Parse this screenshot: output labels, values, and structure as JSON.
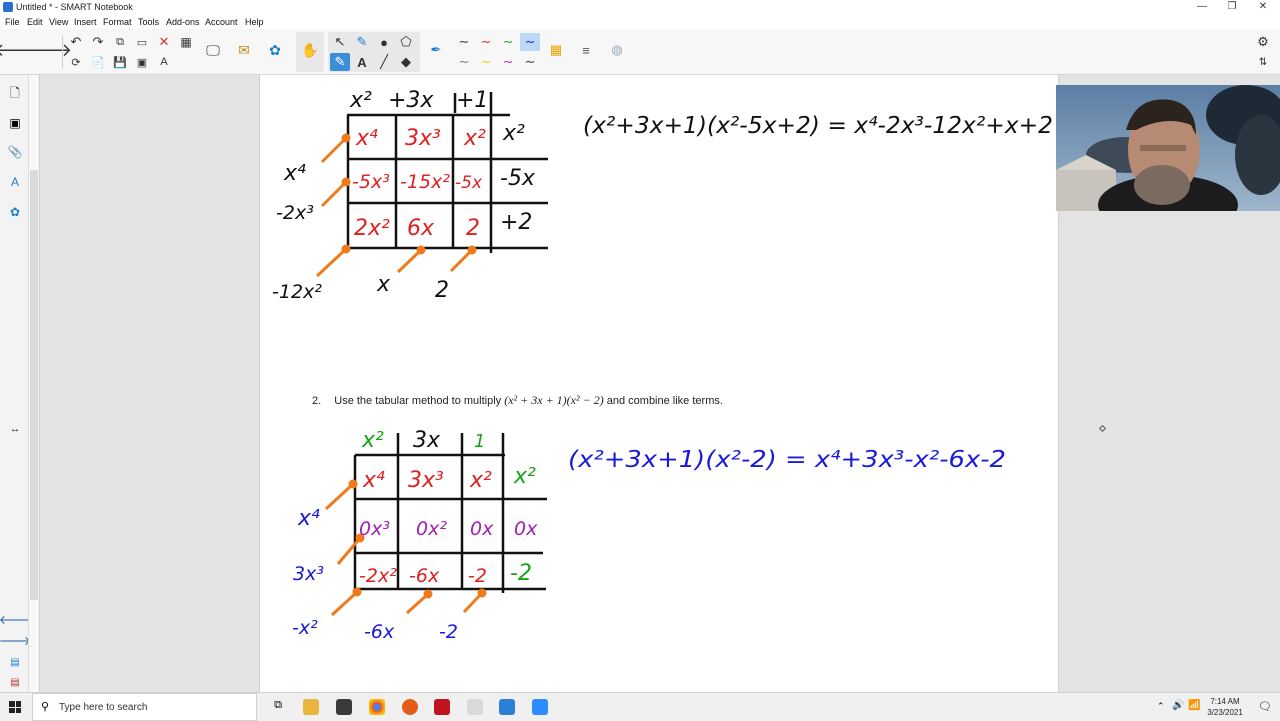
{
  "window": {
    "title": "Untitled * - SMART Notebook",
    "controls": [
      "—",
      "❐",
      "✕"
    ]
  },
  "menu": [
    "File",
    "Edit",
    "View",
    "Insert",
    "Format",
    "Tools",
    "Add-ons",
    "Account",
    "Help"
  ],
  "icons": {
    "back": "back-arrow-icon",
    "forward": "forward-arrow-icon",
    "undo": "undo-icon",
    "redo": "redo-icon",
    "delete": "delete-icon",
    "table": "table-icon",
    "select": "select-arrow-icon",
    "pen": "pen-icon",
    "eraser": "eraser-icon",
    "text": "text-icon",
    "line": "line-icon",
    "settings": "gear-icon"
  },
  "problem2": {
    "number": "2.",
    "prefix": "Use the tabular method to multiply",
    "expression": "(x² + 3x + 1)(x² − 2)",
    "suffix": "and combine like terms."
  },
  "grid1": {
    "top": [
      "x²",
      "+3x",
      "+1"
    ],
    "right": [
      "x²",
      "-5x",
      "+2"
    ],
    "cells": [
      [
        "x⁴",
        "3x³",
        "x²"
      ],
      [
        "-5x³",
        "-15x²",
        "-5x"
      ],
      [
        "2x²",
        "6x",
        "2"
      ]
    ],
    "diagonals": [
      "x⁴",
      "-2x³",
      "-12x²",
      "x",
      "2"
    ],
    "equation": "(x²+3x+1)(x²-5x+2) = x⁴-2x³-12x²+x+2"
  },
  "grid2": {
    "top": [
      "x²",
      "3x",
      "1"
    ],
    "right": [
      "x²",
      "0x",
      "-2"
    ],
    "cells": [
      [
        "x⁴",
        "3x³",
        "x²"
      ],
      [
        "0x³",
        "0x²",
        "0x"
      ],
      [
        "-2x²",
        "-6x",
        "-2"
      ]
    ],
    "diagonals": [
      "x⁴",
      "3x³",
      "-x²",
      "-6x",
      "-2"
    ],
    "equation": "(x²+3x+1)(x²-2) = x⁴+3x³-x²-6x-2"
  },
  "taskbar": {
    "search_placeholder": "Type here to search",
    "time": "7:14 AM",
    "date": "3/23/2021"
  },
  "colors": {
    "red": "#e02020",
    "blue": "#1a1adc",
    "green": "#16a316",
    "purple": "#a020b0",
    "orange": "#f07a1a",
    "black": "#111111"
  }
}
